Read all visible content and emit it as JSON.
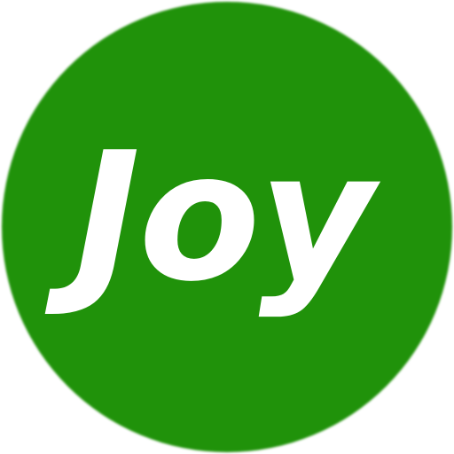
{
  "badge": {
    "label": "Joy",
    "background_color": "#20920A",
    "text_color": "#FFFFFF"
  }
}
